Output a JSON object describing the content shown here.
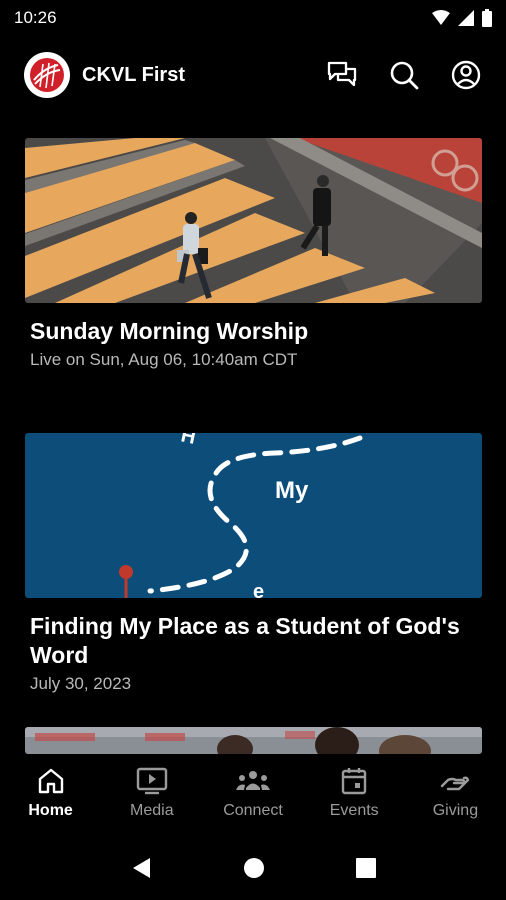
{
  "status": {
    "time": "10:26"
  },
  "app": {
    "title": "CKVL First",
    "icons": [
      "chat-icon",
      "search-icon",
      "account-icon"
    ]
  },
  "cards": [
    {
      "title": "Sunday Morning Worship",
      "subtitle": "Live on Sun, Aug 06, 10:40am CDT"
    },
    {
      "title": "Finding My Place as a Student of God's Word",
      "subtitle": "July 30, 2023",
      "image_text": "My"
    }
  ],
  "colors": {
    "card2_bg": "#0d4d7a",
    "pin": "#c0392b"
  },
  "nav": {
    "items": [
      {
        "label": "Home",
        "icon": "home-icon",
        "active": true
      },
      {
        "label": "Media",
        "icon": "media-icon",
        "active": false
      },
      {
        "label": "Connect",
        "icon": "connect-icon",
        "active": false
      },
      {
        "label": "Events",
        "icon": "events-icon",
        "active": false
      },
      {
        "label": "Giving",
        "icon": "giving-icon",
        "active": false
      }
    ]
  }
}
